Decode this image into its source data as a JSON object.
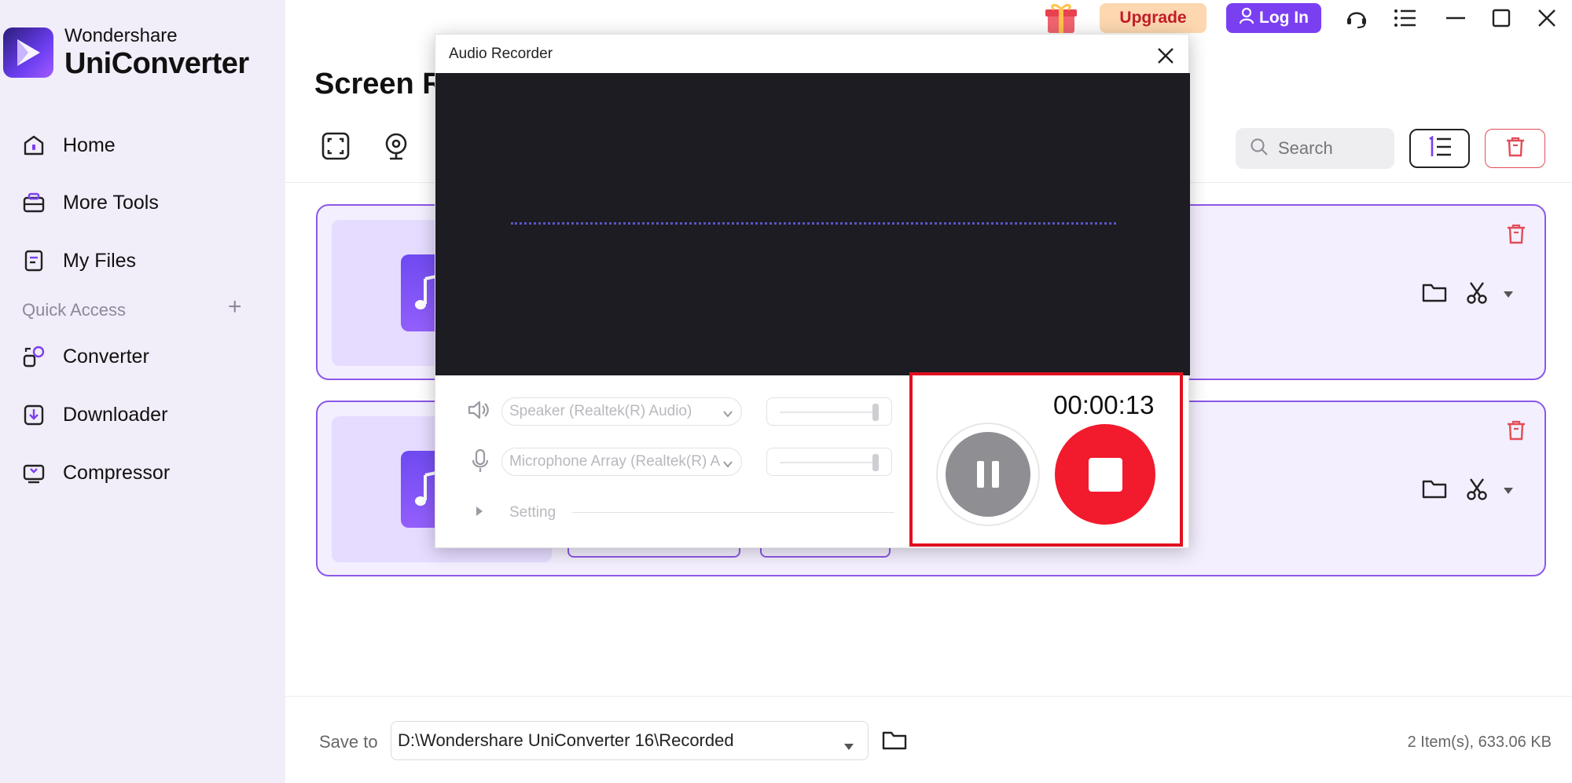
{
  "app": {
    "brand_sub": "Wondershare",
    "brand_main": "UniConverter"
  },
  "sidebar": {
    "items": [
      {
        "label": "Home",
        "icon": "home-icon"
      },
      {
        "label": "More Tools",
        "icon": "toolbox-icon"
      },
      {
        "label": "My Files",
        "icon": "file-icon"
      }
    ],
    "quick_access_label": "Quick Access",
    "quick_items": [
      {
        "label": "Converter",
        "icon": "converter-icon"
      },
      {
        "label": "Downloader",
        "icon": "downloader-icon"
      },
      {
        "label": "Compressor",
        "icon": "compressor-icon"
      }
    ]
  },
  "topbar": {
    "upgrade_label": "Upgrade",
    "login_label": "Log In"
  },
  "main": {
    "page_title": "Screen R",
    "search_placeholder": "Search"
  },
  "footer": {
    "save_to_label": "Save to",
    "save_path": "D:\\Wondershare UniConverter 16\\Recorded",
    "summary": "2 Item(s), 633.06 KB"
  },
  "dialog": {
    "title": "Audio Recorder",
    "speaker_device": "Speaker (Realtek(R) Audio)",
    "mic_device": "Microphone Array (Realtek(R) A",
    "setting_label": "Setting",
    "timer": "00:00:13"
  },
  "colors": {
    "accent": "#7b3ff2",
    "record_red": "#f11b2d",
    "highlight_red": "#e01020",
    "sidebar_bg": "#f1edf9"
  }
}
